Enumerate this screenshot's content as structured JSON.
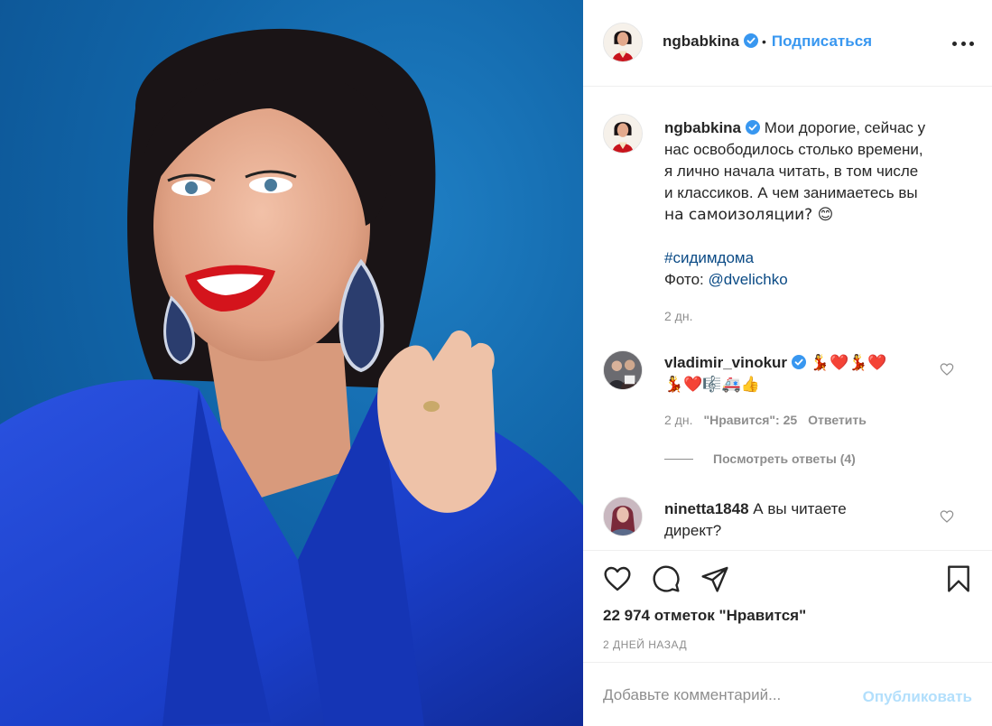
{
  "photo": {
    "alt_icon": "portrait-photo"
  },
  "header": {
    "username": "ngbabkina",
    "separator": "•",
    "follow_label": "Подписаться"
  },
  "caption": {
    "username": "ngbabkina",
    "text_lines": [
      "Мои дорогие, сейчас у",
      "нас освободилось столько времени,",
      "я лично начала читать, в том числе",
      "и классиков. А чем занимаетесь вы",
      "на самоизоляции? 😊"
    ],
    "hashtag": "#сидимдома",
    "photo_credit_label": "Фото:",
    "photo_credit_user": "@dvelichko",
    "time": "2 дн."
  },
  "comments": [
    {
      "username": "vladimir_vinokur",
      "emoji_line1": "💃❤️💃❤️",
      "emoji_line2": "💃❤️🎼🚑👍",
      "time": "2 дн.",
      "likes": "\"Нравится\": 25",
      "reply": "Ответить",
      "view_replies": "Посмотреть ответы (4)"
    },
    {
      "username": "ninetta1848",
      "text_line1": "А вы читаете",
      "text_line2": "директ?"
    }
  ],
  "actions": {
    "likes_count": "22 974 отметок \"Нравится\"",
    "date": "2 ДНЕЙ НАЗАД"
  },
  "add_comment": {
    "placeholder": "Добавьте комментарий...",
    "publish_label": "Опубликовать"
  },
  "colors": {
    "accent": "#3897f0",
    "text": "#262626",
    "muted": "#8e8e8e",
    "publish_disabled": "#b2dffc",
    "photo_background": "#1165a8",
    "jacket": "#1a3ec8"
  }
}
